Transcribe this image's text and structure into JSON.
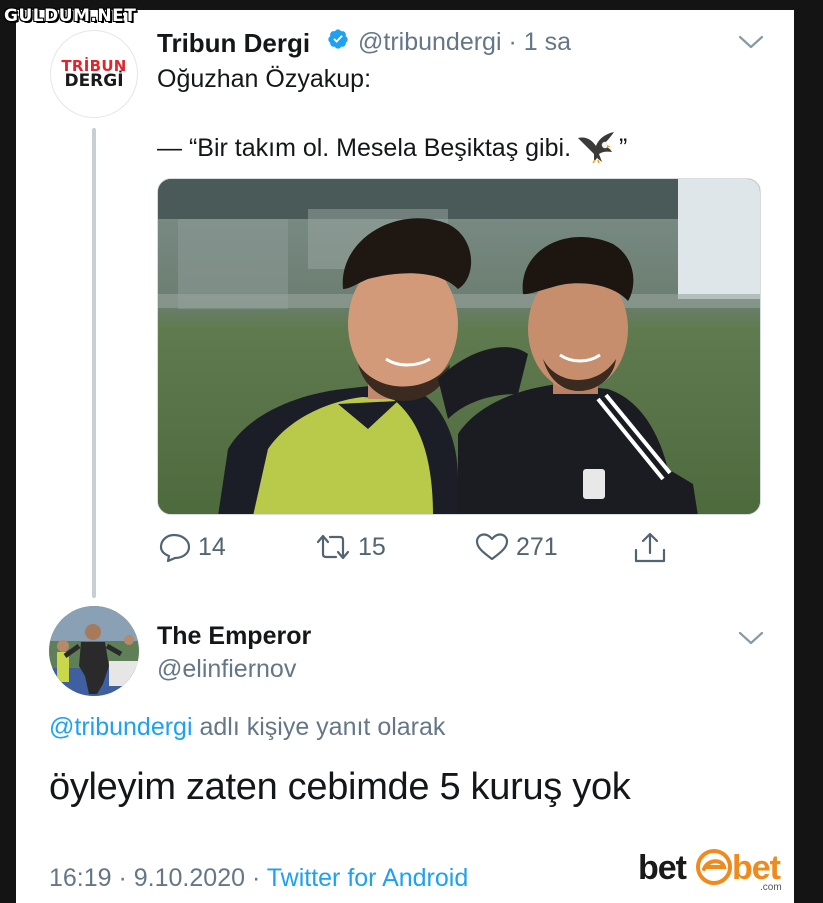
{
  "watermark": "GULDUM.NET",
  "colors": {
    "accent": "#1da1f2",
    "text": "#14171a",
    "muted": "#657786",
    "brand_red": "#e0262b",
    "bet_orange": "#f08a1c"
  },
  "original_tweet": {
    "avatar_text_line1": "TRİBUN",
    "avatar_text_line2": "DERGİ",
    "display_name": "Tribun Dergi",
    "verified_icon": "verified-badge-icon",
    "handle_time": "@tribundergi · 1 sa",
    "text_line1": "Oğuzhan Özyakup:",
    "text_line2_prefix": "— “Bir takım ol. Mesela Beşiktaş gibi.",
    "text_line2_suffix": "”",
    "inline_emoji": "eagle-emoji-icon",
    "actions": {
      "reply_count": "14",
      "retweet_count": "15",
      "like_count": "271",
      "share_icon": "share-icon"
    }
  },
  "reply_tweet": {
    "display_name": "The Emperor",
    "handle": "@elinfiernov",
    "replying_to_mention": "@tribundergi",
    "replying_to_suffix": " adlı kişiye yanıt olarak",
    "text": "öyleyim zaten cebimde 5 kuruş yok",
    "timestamp": "16:19 · 9.10.2020 · ",
    "source": "Twitter for Android"
  },
  "sponsor_logo": {
    "left": "bet",
    "right": "bet",
    "domain": ".com"
  }
}
